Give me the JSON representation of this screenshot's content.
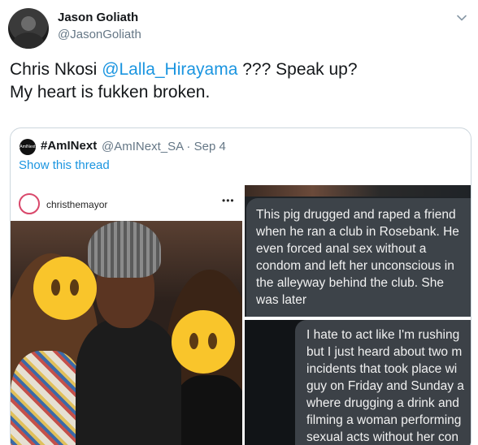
{
  "author": {
    "name": "Jason Goliath",
    "handle": "@JasonGoliath"
  },
  "tweet": {
    "text_before": "Chris Nkosi ",
    "mention": "@Lalla_Hirayama",
    "text_after_line1": " ???  Speak up?",
    "text_line2": "My heart is fukken broken."
  },
  "quoted": {
    "logo_text": "AmINext",
    "name": "#AmINext",
    "meta": "@AmINext_SA · Sep 4",
    "show_thread": "Show this thread",
    "instagram_user": "christhemayor",
    "instagram_more": "•••",
    "message_1": "This pig drugged and raped a friend when he ran a club in Rosebank. He even forced anal sex without a condom and left her unconscious in the alleyway behind the club. She was later",
    "message_2_lines": [
      "I hate to act like I'm rushing",
      "but I just heard about two m",
      "incidents that took place wi",
      "guy on Friday and Sunday a",
      "where drugging a drink and",
      "filming a woman performing",
      "sexual acts without her con"
    ]
  },
  "colors": {
    "link": "#1b95e0",
    "muted": "#657786",
    "emoji": "#f9c52b"
  },
  "icons": {
    "menu": "chevron-down-icon"
  }
}
